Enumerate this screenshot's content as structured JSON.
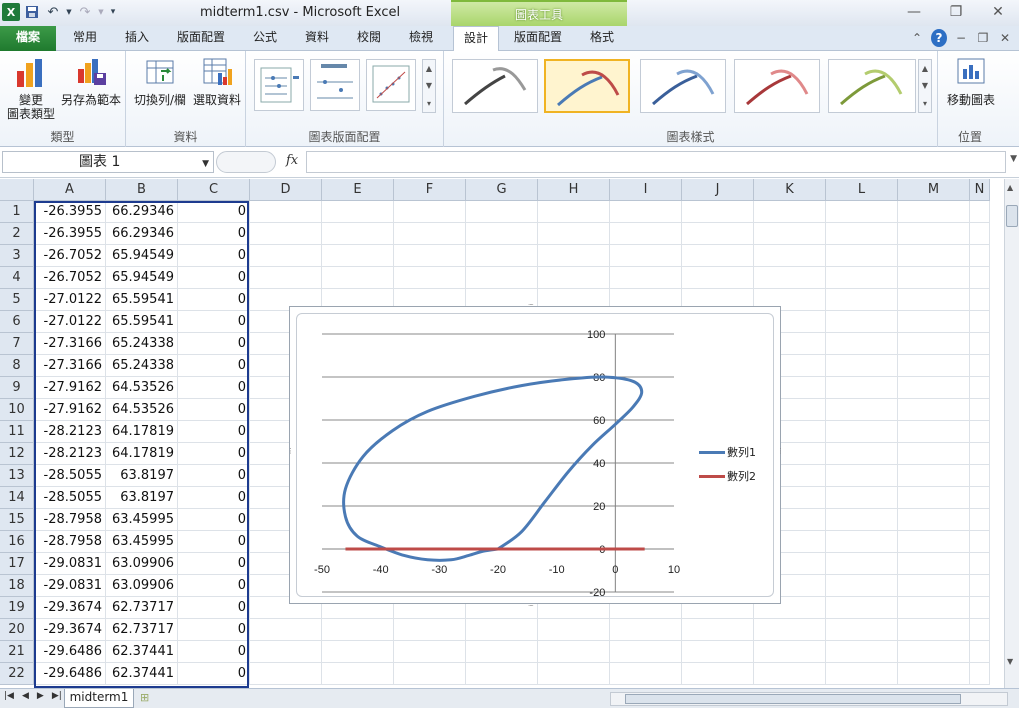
{
  "window": {
    "title": "midterm1.csv - Microsoft Excel",
    "context_band": "圖表工具"
  },
  "qat": {
    "logo": "X",
    "save_icon": "save-icon",
    "undo_icon": "undo-icon",
    "redo_icon": "redo-icon"
  },
  "tabs": {
    "file": "檔案",
    "items": [
      "常用",
      "插入",
      "版面配置",
      "公式",
      "資料",
      "校閱",
      "檢視"
    ],
    "ctx": [
      "設計",
      "版面配置",
      "格式"
    ]
  },
  "ribbon": {
    "groups": {
      "type": "類型",
      "data": "資料",
      "layout": "圖表版面配置",
      "styles": "圖表樣式",
      "location": "位置"
    },
    "buttons": {
      "change_type": "變更\n圖表類型",
      "change_type_l1": "變更",
      "change_type_l2": "圖表類型",
      "save_template": "另存為範本",
      "switch_row_col": "切換列/欄",
      "select_data": "選取資料",
      "move_chart": "移動圖表"
    }
  },
  "formula_bar": {
    "name_box": "圖表 1",
    "fx": "fx",
    "value": ""
  },
  "sheet": {
    "columns": [
      "A",
      "B",
      "C",
      "D",
      "E",
      "F",
      "G",
      "H",
      "I",
      "J",
      "K",
      "L",
      "M",
      "N"
    ],
    "rows": [
      {
        "n": "1",
        "a": "-26.3955",
        "b": "66.29346",
        "c": "0"
      },
      {
        "n": "2",
        "a": "-26.3955",
        "b": "66.29346",
        "c": "0"
      },
      {
        "n": "3",
        "a": "-26.7052",
        "b": "65.94549",
        "c": "0"
      },
      {
        "n": "4",
        "a": "-26.7052",
        "b": "65.94549",
        "c": "0"
      },
      {
        "n": "5",
        "a": "-27.0122",
        "b": "65.59541",
        "c": "0"
      },
      {
        "n": "6",
        "a": "-27.0122",
        "b": "65.59541",
        "c": "0"
      },
      {
        "n": "7",
        "a": "-27.3166",
        "b": "65.24338",
        "c": "0"
      },
      {
        "n": "8",
        "a": "-27.3166",
        "b": "65.24338",
        "c": "0"
      },
      {
        "n": "9",
        "a": "-27.9162",
        "b": "64.53526",
        "c": "0"
      },
      {
        "n": "10",
        "a": "-27.9162",
        "b": "64.53526",
        "c": "0"
      },
      {
        "n": "11",
        "a": "-28.2123",
        "b": "64.17819",
        "c": "0"
      },
      {
        "n": "12",
        "a": "-28.2123",
        "b": "64.17819",
        "c": "0"
      },
      {
        "n": "13",
        "a": "-28.5055",
        "b": "63.8197",
        "c": "0"
      },
      {
        "n": "14",
        "a": "-28.5055",
        "b": "63.8197",
        "c": "0"
      },
      {
        "n": "15",
        "a": "-28.7958",
        "b": "63.45995",
        "c": "0"
      },
      {
        "n": "16",
        "a": "-28.7958",
        "b": "63.45995",
        "c": "0"
      },
      {
        "n": "17",
        "a": "-29.0831",
        "b": "63.09906",
        "c": "0"
      },
      {
        "n": "18",
        "a": "-29.0831",
        "b": "63.09906",
        "c": "0"
      },
      {
        "n": "19",
        "a": "-29.3674",
        "b": "62.73717",
        "c": "0"
      },
      {
        "n": "20",
        "a": "-29.3674",
        "b": "62.73717",
        "c": "0"
      },
      {
        "n": "21",
        "a": "-29.6486",
        "b": "62.37441",
        "c": "0"
      },
      {
        "n": "22",
        "a": "-29.6486",
        "b": "62.37441",
        "c": "0"
      }
    ],
    "tab_name": "midterm1"
  },
  "colors": {
    "series1": "#4a7ab5",
    "series2": "#be4b48",
    "selection": "#1d3b8f",
    "ctx_band": "#a9d56b"
  },
  "chart_data": {
    "type": "scatter",
    "title": "",
    "xlabel": "",
    "ylabel": "",
    "xlim": [
      -50,
      10
    ],
    "ylim": [
      -20,
      100
    ],
    "x_ticks": [
      "-50",
      "-40",
      "-30",
      "-20",
      "-10",
      "0",
      "10"
    ],
    "y_ticks": [
      "100",
      "80",
      "60",
      "40",
      "20",
      "0",
      "-20"
    ],
    "grid": "horizontal",
    "legend_position": "right",
    "series": [
      {
        "name": "數列1",
        "x": [
          -20,
          -16,
          -12,
          -8,
          -4,
          0,
          3,
          4.5,
          3,
          -2,
          -8,
          -16,
          -24,
          -32,
          -38,
          -43,
          -46,
          -46,
          -44,
          -40,
          -36,
          -32,
          -28,
          -25,
          -22.5,
          -20
        ],
        "y": [
          0,
          8,
          22,
          36,
          48,
          58,
          66,
          73,
          78,
          80,
          79,
          76,
          71,
          64,
          55,
          43,
          28,
          15,
          6,
          1,
          -3,
          -5,
          -5,
          -3,
          -1,
          0
        ]
      },
      {
        "name": "數列2",
        "x": [
          -46,
          -40,
          -30,
          -20,
          -10,
          0,
          5
        ],
        "y": [
          0,
          0,
          0,
          0,
          0,
          0,
          0
        ]
      }
    ]
  }
}
